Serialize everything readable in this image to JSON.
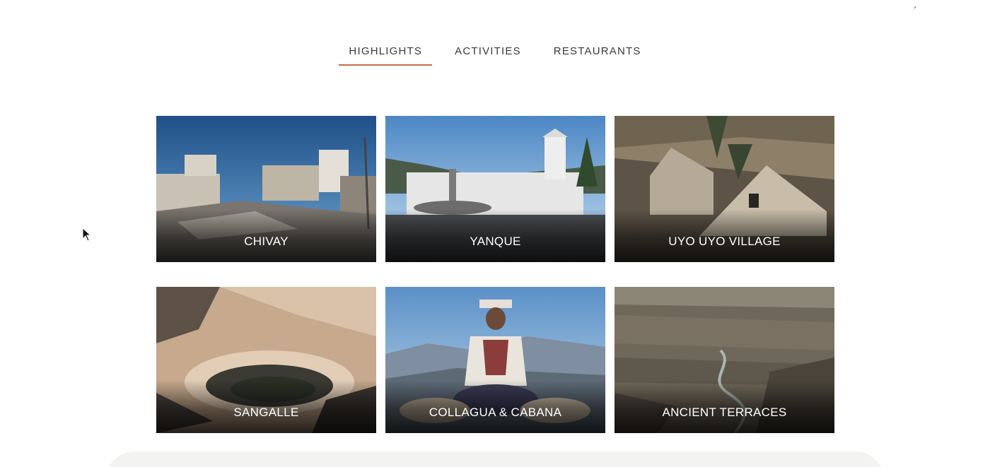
{
  "tabs": [
    {
      "label": "HIGHLIGHTS",
      "active": true
    },
    {
      "label": "ACTIVITIES",
      "active": false
    },
    {
      "label": "RESTAURANTS",
      "active": false
    }
  ],
  "accent_color": "#c26a44",
  "cards": [
    {
      "title": "CHIVAY"
    },
    {
      "title": "YANQUE"
    },
    {
      "title": "UYO UYO VILLAGE"
    },
    {
      "title": "SANGALLE"
    },
    {
      "title": "COLLAGUA & CABANA"
    },
    {
      "title": "ANCIENT TERRACES"
    }
  ]
}
